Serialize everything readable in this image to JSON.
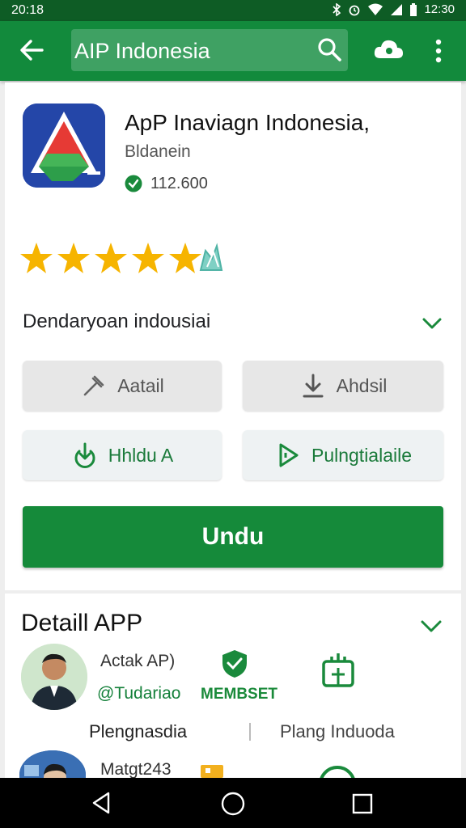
{
  "status_bar": {
    "time_left": "20:18",
    "time_right": "12:30"
  },
  "app_bar": {
    "search_query": "AIP Indonesia"
  },
  "app": {
    "title": "ApP Inaviagn Indonesia,",
    "developer": "Bldanein",
    "downloads": "112.600",
    "rating_stars": 5
  },
  "section": {
    "label": "Dendaryoan indousiai"
  },
  "chips": {
    "chip1": "Aatail",
    "chip2": "Ahdsil",
    "chip3": "Hhldu A",
    "chip4": "Pulngtialaile"
  },
  "install": {
    "label": "Undu"
  },
  "details": {
    "title": "Detaill APP",
    "dev_name": "Actak AP)",
    "dev_handle": "@Tudariao",
    "member_label": "MEMBSET",
    "row_left": "Plengnasdia",
    "row_right": "Plang Induoda",
    "dev_name2": "Matgt243"
  },
  "colors": {
    "primary": "#128a3c",
    "status_bar": "#0e5c25",
    "star": "#f6b400"
  }
}
